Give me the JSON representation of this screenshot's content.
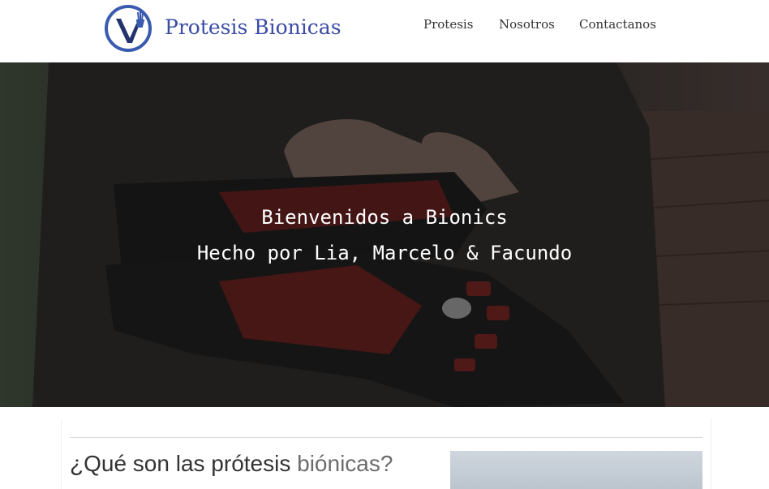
{
  "header": {
    "brand": "Protesis Bionicas",
    "logo_icon": "prosthetic-hand-v-logo-icon",
    "nav": [
      {
        "label": "Protesis"
      },
      {
        "label": "Nosotros"
      },
      {
        "label": "Contactanos"
      }
    ]
  },
  "hero": {
    "line1": "Bienvenidos a Bionics",
    "line2": "Hecho por Lia, Marcelo & Facundo",
    "image": "bionic-prosthetic-arm-photo"
  },
  "section": {
    "title_main": "¿Qué son las prótesis ",
    "title_muted": "biónicas?",
    "image": "prosthesis-photo"
  },
  "colors": {
    "brand": "#3a4ca4",
    "text": "#333333",
    "hero_overlay": "#2c2b29"
  }
}
